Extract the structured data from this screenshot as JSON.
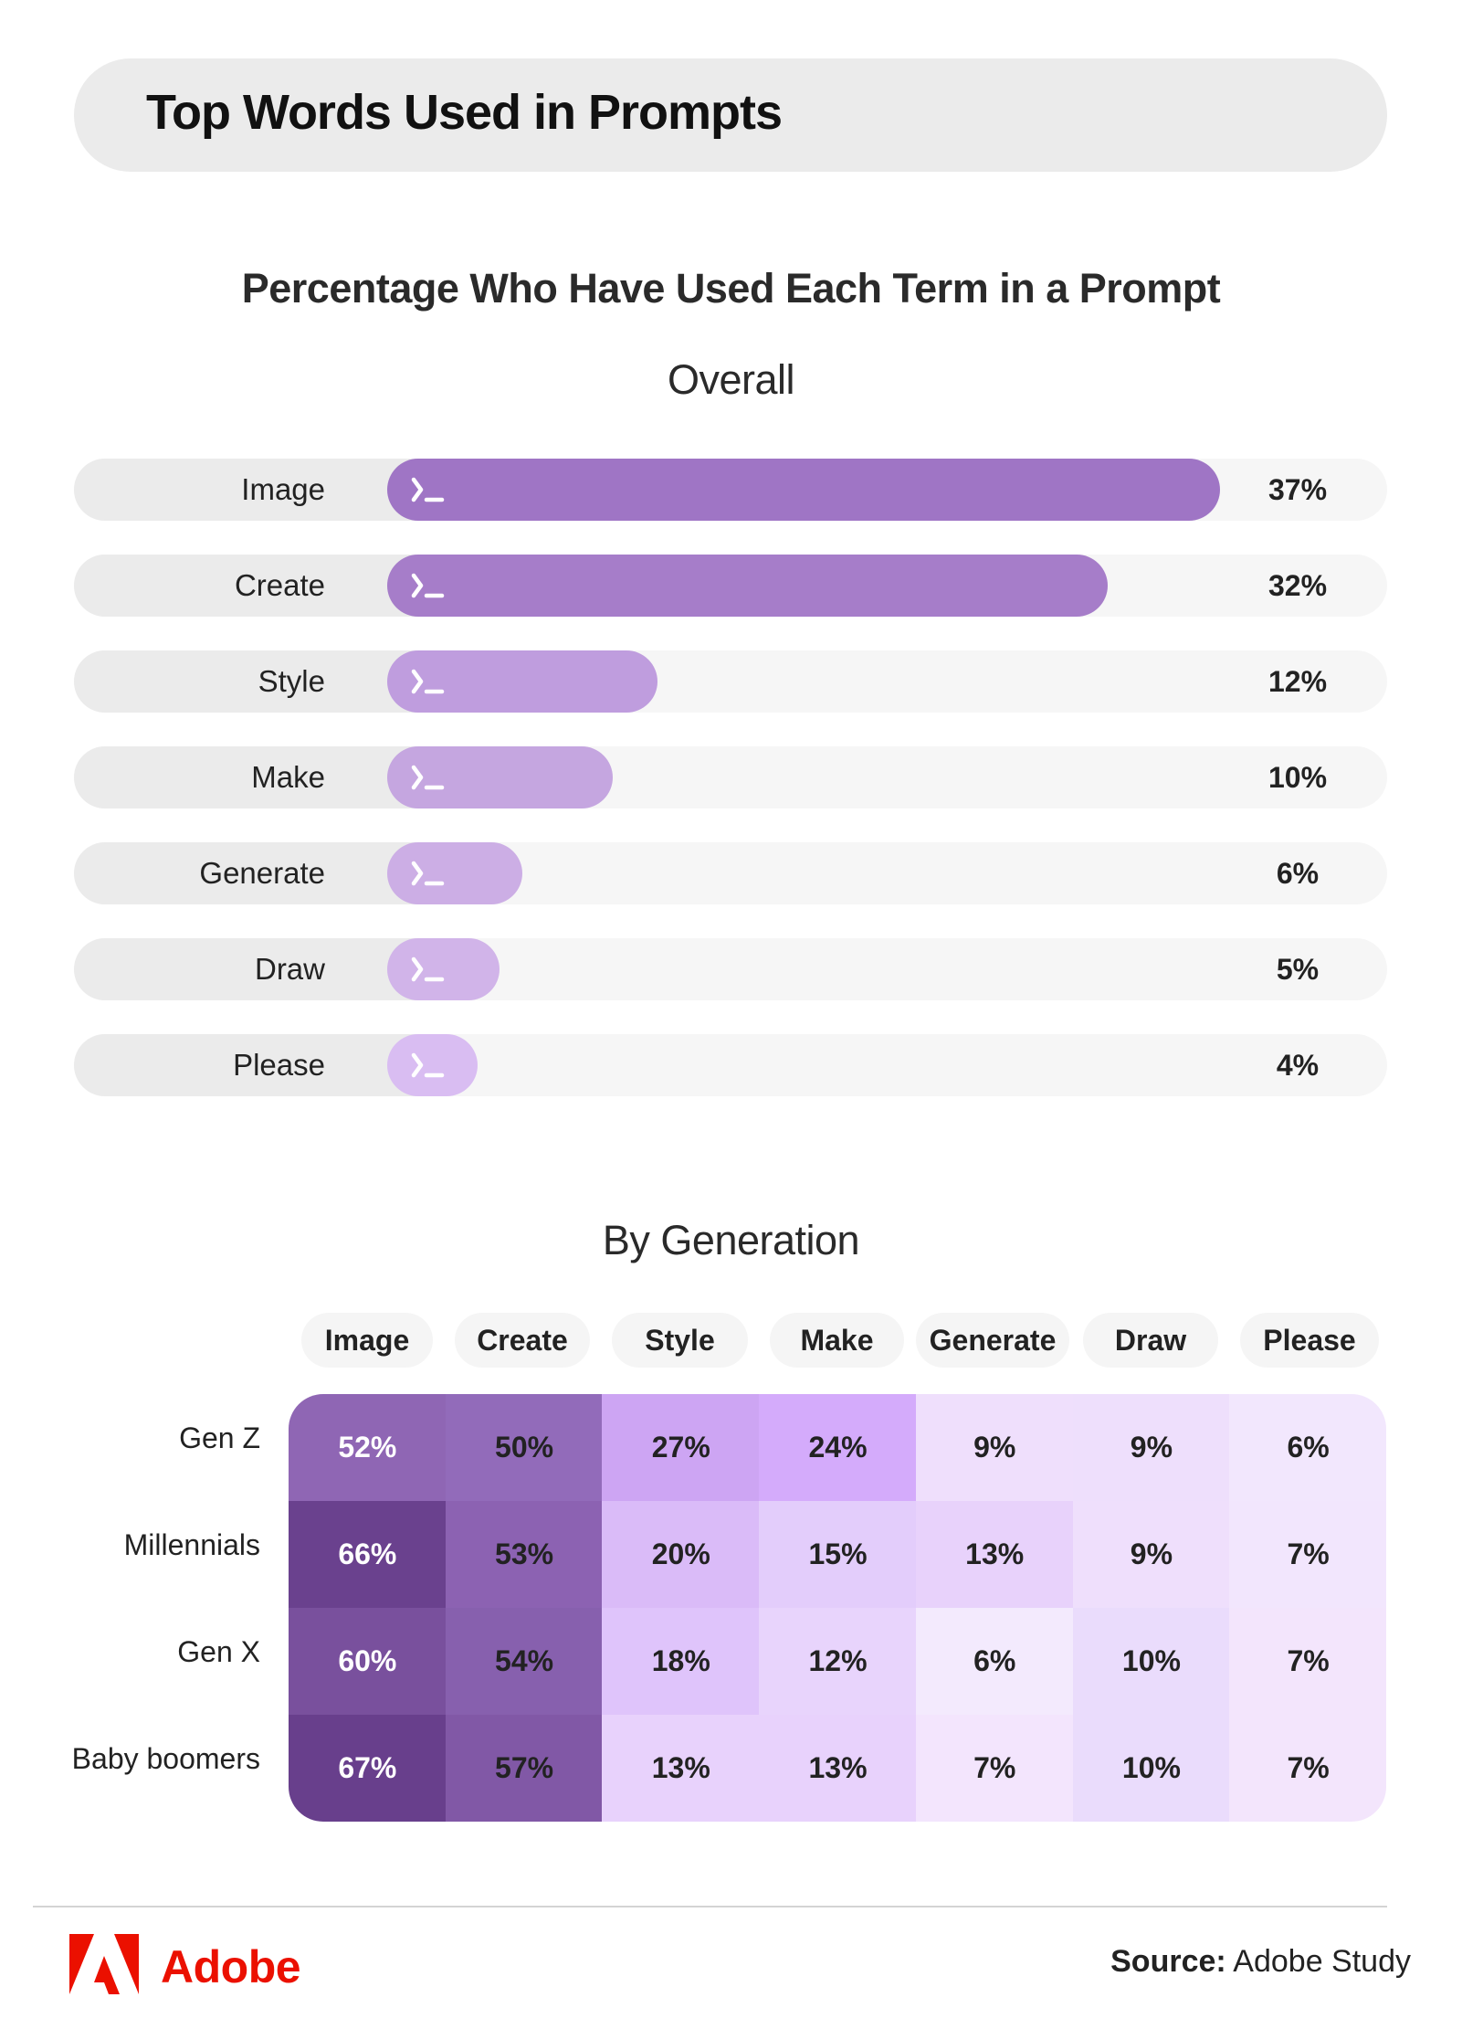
{
  "header": {
    "title": "Top Words Used in Prompts"
  },
  "subtitle": "Percentage Who Have Used Each Term in a Prompt",
  "colors": {
    "brand_red": "#eb1000",
    "bar_colors": [
      "#9f75c5",
      "#a67dc9",
      "#bf9dde",
      "#c5a6e0",
      "#ccaee5",
      "#d1b4e9",
      "#d9bdf2"
    ]
  },
  "chart_data": [
    {
      "type": "bar",
      "orientation": "horizontal",
      "title": "Overall",
      "categories": [
        "Image",
        "Create",
        "Style",
        "Make",
        "Generate",
        "Draw",
        "Please"
      ],
      "values": [
        37,
        32,
        12,
        10,
        6,
        5,
        4
      ],
      "value_labels": [
        "37%",
        "32%",
        "12%",
        "10%",
        "6%",
        "5%",
        "4%"
      ],
      "unit": "%",
      "xlabel": "",
      "ylabel": "",
      "grid": false,
      "icon": "terminal-prompt-icon"
    },
    {
      "type": "heatmap",
      "title": "By Generation",
      "columns": [
        "Image",
        "Create",
        "Style",
        "Make",
        "Generate",
        "Draw",
        "Please"
      ],
      "rows": [
        "Gen Z",
        "Millennials",
        "Gen X",
        "Baby boomers"
      ],
      "values": [
        [
          52,
          50,
          27,
          24,
          9,
          9,
          6
        ],
        [
          66,
          53,
          20,
          15,
          13,
          9,
          7
        ],
        [
          60,
          54,
          18,
          12,
          6,
          10,
          7
        ],
        [
          67,
          57,
          13,
          13,
          7,
          10,
          7
        ]
      ],
      "cell_colors": [
        [
          "#8f66b4",
          "#926bba",
          "#cda5f3",
          "#d4abfb",
          "#efdffc",
          "#eedffc",
          "#f2e7fd"
        ],
        [
          "#6a418e",
          "#8c62b2",
          "#dabbf8",
          "#e3cdfb",
          "#e8d2fb",
          "#efdffc",
          "#f2e6fd"
        ],
        [
          "#79509d",
          "#8760ae",
          "#dfc4fb",
          "#e8d4fc",
          "#f3eafd",
          "#eadcfc",
          "#f3e5fc"
        ],
        [
          "#683f8c",
          "#8158a6",
          "#e8d2fc",
          "#e8d2fc",
          "#f3e5fd",
          "#eadcfc",
          "#f3e5fc"
        ]
      ],
      "text_colors": [
        [
          "#ffffff",
          "#222222",
          "#222222",
          "#222222",
          "#222222",
          "#222222",
          "#222222"
        ],
        [
          "#ffffff",
          "#222222",
          "#222222",
          "#222222",
          "#222222",
          "#222222",
          "#222222"
        ],
        [
          "#ffffff",
          "#222222",
          "#222222",
          "#222222",
          "#222222",
          "#222222",
          "#222222"
        ],
        [
          "#ffffff",
          "#222222",
          "#222222",
          "#222222",
          "#222222",
          "#222222",
          "#222222"
        ]
      ],
      "unit": "%"
    }
  ],
  "footer": {
    "brand": "Adobe",
    "source_label": "Source:",
    "source_value": "Adobe Study"
  }
}
